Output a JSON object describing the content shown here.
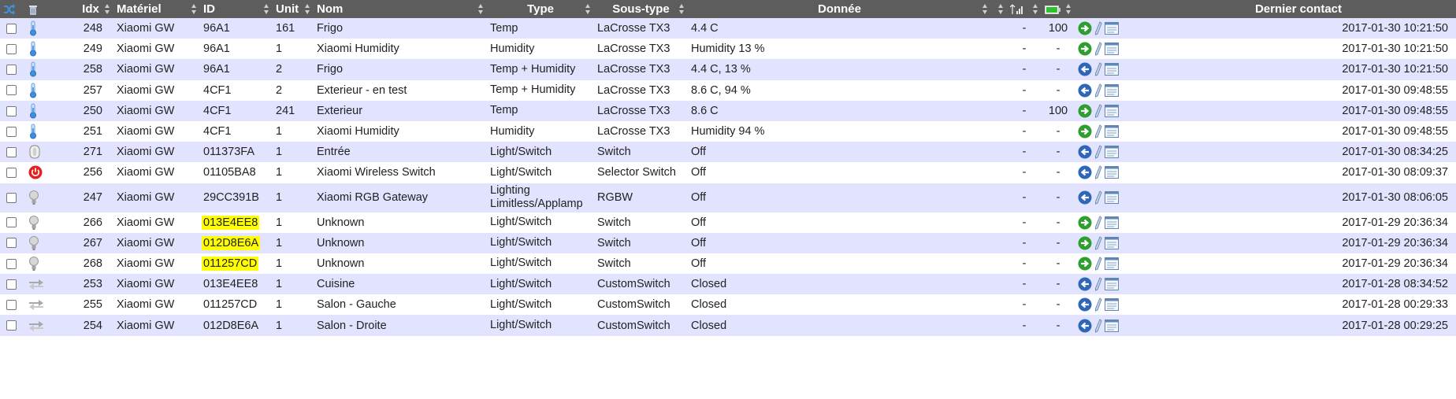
{
  "header": {
    "idx": "Idx",
    "materiel": "Matériel",
    "id": "ID",
    "unit": "Unit",
    "nom": "Nom",
    "type": "Type",
    "soustype": "Sous-type",
    "donnee": "Donnée",
    "contact": "Dernier contact",
    "icons": [
      "shuffle-icon",
      "trash-icon",
      "signal-icon",
      "battery-icon"
    ]
  },
  "colors": {
    "header_bg": "#5d5d5d",
    "row_odd": "#e2e4ff",
    "row_even": "#ffffff",
    "highlight": "#ffff00"
  },
  "rows": [
    {
      "icon": "thermometer",
      "idx": "248",
      "materiel": "Xiaomi GW",
      "id": "96A1",
      "unit": "161",
      "nom": "Frigo",
      "type": "Temp",
      "soustype": "LaCrosse TX3",
      "donnee": "4.4 C",
      "signal": "-",
      "battery": "100",
      "arrow": "green",
      "contact": "2017-01-30 10:21:50"
    },
    {
      "icon": "thermometer",
      "idx": "249",
      "materiel": "Xiaomi GW",
      "id": "96A1",
      "unit": "1",
      "nom": "Xiaomi Humidity",
      "type": "Humidity",
      "soustype": "LaCrosse TX3",
      "donnee": "Humidity 13 %",
      "signal": "-",
      "battery": "-",
      "arrow": "green",
      "contact": "2017-01-30 10:21:50"
    },
    {
      "icon": "thermometer",
      "idx": "258",
      "materiel": "Xiaomi GW",
      "id": "96A1",
      "unit": "2",
      "nom": "Frigo",
      "type": "Temp + Humidity",
      "soustype": "LaCrosse TX3",
      "donnee": "4.4 C, 13 %",
      "signal": "-",
      "battery": "-",
      "arrow": "blue",
      "contact": "2017-01-30 10:21:50"
    },
    {
      "icon": "thermometer",
      "idx": "257",
      "materiel": "Xiaomi GW",
      "id": "4CF1",
      "unit": "2",
      "nom": "Exterieur - en test",
      "type": "Temp + Humidity",
      "soustype": "LaCrosse TX3",
      "donnee": "8.6 C, 94 %",
      "signal": "-",
      "battery": "-",
      "arrow": "blue",
      "contact": "2017-01-30 09:48:55"
    },
    {
      "icon": "thermometer",
      "idx": "250",
      "materiel": "Xiaomi GW",
      "id": "4CF1",
      "unit": "241",
      "nom": "Exterieur",
      "type": "Temp",
      "soustype": "LaCrosse TX3",
      "donnee": "8.6 C",
      "signal": "-",
      "battery": "100",
      "arrow": "green",
      "contact": "2017-01-30 09:48:55"
    },
    {
      "icon": "thermometer",
      "idx": "251",
      "materiel": "Xiaomi GW",
      "id": "4CF1",
      "unit": "1",
      "nom": "Xiaomi Humidity",
      "type": "Humidity",
      "soustype": "LaCrosse TX3",
      "donnee": "Humidity 94 %",
      "signal": "-",
      "battery": "-",
      "arrow": "green",
      "contact": "2017-01-30 09:48:55"
    },
    {
      "icon": "door",
      "idx": "271",
      "materiel": "Xiaomi GW",
      "id": "011373FA",
      "unit": "1",
      "nom": "Entrée",
      "type": "Light/Switch",
      "soustype": "Switch",
      "donnee": "Off",
      "signal": "-",
      "battery": "-",
      "arrow": "blue",
      "contact": "2017-01-30 08:34:25"
    },
    {
      "icon": "power",
      "idx": "256",
      "materiel": "Xiaomi GW",
      "id": "01105BA8",
      "unit": "1",
      "nom": "Xiaomi Wireless Switch",
      "type": "Light/Switch",
      "soustype": "Selector Switch",
      "donnee": "Off",
      "signal": "-",
      "battery": "-",
      "arrow": "blue",
      "contact": "2017-01-30 08:09:37"
    },
    {
      "icon": "bulb",
      "idx": "247",
      "materiel": "Xiaomi GW",
      "id": "29CC391B",
      "unit": "1",
      "nom": "Xiaomi RGB Gateway",
      "type": "Lighting Limitless/Applamp",
      "soustype": "RGBW",
      "donnee": "Off",
      "signal": "-",
      "battery": "-",
      "arrow": "blue",
      "contact": "2017-01-30 08:06:05",
      "tall": true
    },
    {
      "icon": "bulb",
      "idx": "266",
      "materiel": "Xiaomi GW",
      "id": "013E4EE8",
      "highlight": true,
      "unit": "1",
      "nom": "Unknown",
      "type": "Light/Switch",
      "soustype": "Switch",
      "donnee": "Off",
      "signal": "-",
      "battery": "-",
      "arrow": "green",
      "contact": "2017-01-29 20:36:34"
    },
    {
      "icon": "bulb",
      "idx": "267",
      "materiel": "Xiaomi GW",
      "id": "012D8E6A",
      "highlight": true,
      "unit": "1",
      "nom": "Unknown",
      "type": "Light/Switch",
      "soustype": "Switch",
      "donnee": "Off",
      "signal": "-",
      "battery": "-",
      "arrow": "green",
      "contact": "2017-01-29 20:36:34"
    },
    {
      "icon": "bulb",
      "idx": "268",
      "materiel": "Xiaomi GW",
      "id": "011257CD",
      "highlight": true,
      "unit": "1",
      "nom": "Unknown",
      "type": "Light/Switch",
      "soustype": "Switch",
      "donnee": "Off",
      "signal": "-",
      "battery": "-",
      "arrow": "green",
      "contact": "2017-01-29 20:36:34"
    },
    {
      "icon": "arrows",
      "idx": "253",
      "materiel": "Xiaomi GW",
      "id": "013E4EE8",
      "unit": "1",
      "nom": "Cuisine",
      "type": "Light/Switch",
      "soustype": "CustomSwitch",
      "donnee": "Closed",
      "signal": "-",
      "battery": "-",
      "arrow": "blue",
      "contact": "2017-01-28 08:34:52"
    },
    {
      "icon": "arrows",
      "idx": "255",
      "materiel": "Xiaomi GW",
      "id": "011257CD",
      "unit": "1",
      "nom": "Salon - Gauche",
      "type": "Light/Switch",
      "soustype": "CustomSwitch",
      "donnee": "Closed",
      "signal": "-",
      "battery": "-",
      "arrow": "blue",
      "contact": "2017-01-28 00:29:33"
    },
    {
      "icon": "arrows",
      "idx": "254",
      "materiel": "Xiaomi GW",
      "id": "012D8E6A",
      "unit": "1",
      "nom": "Salon - Droite",
      "type": "Light/Switch",
      "soustype": "CustomSwitch",
      "donnee": "Closed",
      "signal": "-",
      "battery": "-",
      "arrow": "blue",
      "contact": "2017-01-28 00:29:25"
    }
  ]
}
